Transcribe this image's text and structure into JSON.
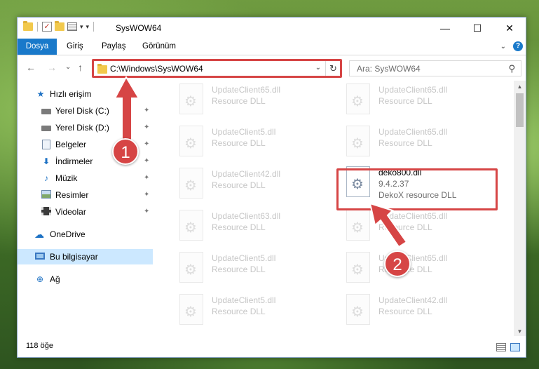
{
  "window": {
    "title": "SysWOW64",
    "minimize": "—",
    "maximize": "☐",
    "close": "✕"
  },
  "quick_access_toolbar": {
    "dropdown_glyph": "▾",
    "customize_glyph": "▾"
  },
  "ribbon": {
    "tabs": [
      "Dosya",
      "Giriş",
      "Paylaş",
      "Görünüm"
    ],
    "expand_glyph": "⌄",
    "help_glyph": "?"
  },
  "nav": {
    "back": "←",
    "forward": "→",
    "recent": "⌄",
    "up": "↑",
    "address_path": "C:\\Windows\\SysWOW64",
    "address_dropdown": "⌄",
    "refresh": "↻",
    "search_placeholder": "Ara: SysWOW64",
    "search_icon": "⚲"
  },
  "sidebar": {
    "items": [
      {
        "label": "Hızlı erişim",
        "icon": "star-icon"
      },
      {
        "label": "Yerel Disk (C:)",
        "icon": "drive-icon",
        "pin": "📌"
      },
      {
        "label": "Yerel Disk (D:)",
        "icon": "drive-icon",
        "pin": "📌"
      },
      {
        "label": "Belgeler",
        "icon": "document-icon",
        "pin": "📌"
      },
      {
        "label": "İndirmeler",
        "icon": "download-icon",
        "pin": "📌"
      },
      {
        "label": "Müzik",
        "icon": "music-icon",
        "pin": "📌"
      },
      {
        "label": "Resimler",
        "icon": "picture-icon",
        "pin": "📌"
      },
      {
        "label": "Videolar",
        "icon": "video-icon",
        "pin": "📌"
      },
      {
        "label": "OneDrive",
        "icon": "cloud-icon"
      },
      {
        "label": "Bu bilgisayar",
        "icon": "computer-icon"
      },
      {
        "label": "Ağ",
        "icon": "network-icon"
      }
    ],
    "glyphs": {
      "star": "★",
      "download": "⬇",
      "music": "♪",
      "cloud": "☁",
      "network": "⊕",
      "pin": "✦"
    }
  },
  "files": {
    "left_column": [
      {
        "name": "UpdateClient65.dll",
        "desc": "Resource DLL"
      },
      {
        "name": "UpdateClient5.dll",
        "desc": "Resource DLL"
      },
      {
        "name": "UpdateClient42.dll",
        "desc": "Resource DLL"
      },
      {
        "name": "UpdateClient63.dll",
        "desc": "Resource DLL"
      },
      {
        "name": "UpdateClient5.dll",
        "desc": "Resource DLL"
      },
      {
        "name": "UpdateClient5.dll",
        "desc": "Resource DLL"
      }
    ],
    "right_column": [
      {
        "name": "UpdateClient65.dll",
        "desc": "Resource DLL"
      },
      {
        "name": "UpdateClient65.dll",
        "desc": "Resource DLL"
      },
      {
        "name": "deko800.dll",
        "version": "9.4.2.37",
        "desc": "DekoX resource DLL",
        "active": true
      },
      {
        "name": "UpdateClient65.dll",
        "desc": "Resource DLL"
      },
      {
        "name": "UpdateClient65.dll",
        "desc": "Resource DLL"
      },
      {
        "name": "UpdateClient42.dll",
        "desc": "Resource DLL"
      }
    ]
  },
  "scrollbar": {
    "up": "▲",
    "down": "▼"
  },
  "status": {
    "item_count": "118 öğe"
  },
  "annotations": {
    "step1": "1",
    "step2": "2",
    "color": "#d64545"
  }
}
